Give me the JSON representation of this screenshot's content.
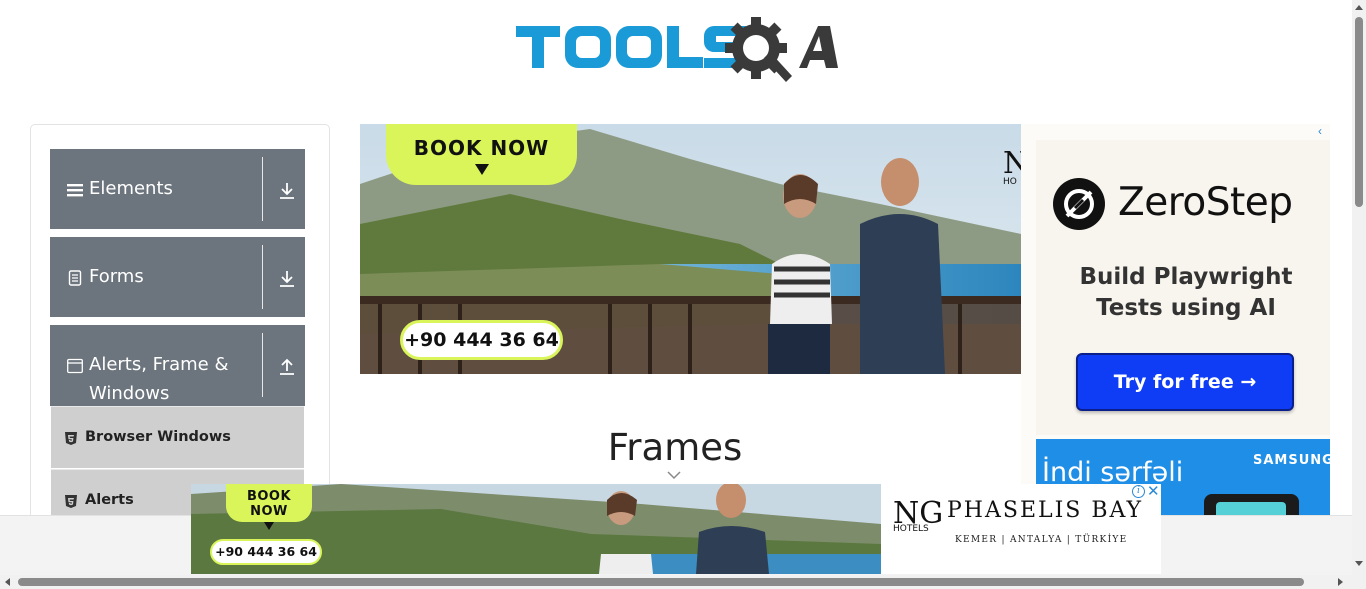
{
  "brand": {
    "logo_text": "TOOLSQA"
  },
  "sidebar": {
    "groups": [
      {
        "label": "Elements",
        "icon": "hamburger-icon",
        "arrow": "download-arrow-icon"
      },
      {
        "label": "Forms",
        "icon": "document-icon",
        "arrow": "download-arrow-icon"
      },
      {
        "label": "Alerts, Frame &",
        "label2": "Windows",
        "icon": "window-icon",
        "arrow": "upload-arrow-icon"
      }
    ],
    "items": [
      {
        "label": "Browser Windows",
        "icon": "html5-icon"
      },
      {
        "label": "Alerts",
        "icon": "html5-icon"
      }
    ]
  },
  "hero_ad": {
    "book_now": "BOOK NOW",
    "phone": "+90 444 36 64",
    "brand_partial": "N",
    "brand_partial_small": "HO"
  },
  "side_ad": {
    "name": "ZeroStep",
    "tagline_line1": "Build Playwright",
    "tagline_line2": "Tests using AI",
    "cta": "Try for free →",
    "promo_text": "İndi sərfəli",
    "promo_brand": "SAMSUNG",
    "adchoices": "‹"
  },
  "main": {
    "title": "Frames"
  },
  "bottom_ad": {
    "book_now": "BOOK NOW",
    "phone": "+90 444 36 64",
    "ng": "NG",
    "ng_small": "HOTELS",
    "hotel": "PHASELIS BAY",
    "location": "KEMER | ANTALYA | TÜRKİYE",
    "info": "i",
    "close": "✕"
  },
  "colors": {
    "accent_blue": "#1a9ad6",
    "menu_gray": "#6c757d",
    "lime": "#d9f55a",
    "cta_blue": "#0f3df5"
  }
}
